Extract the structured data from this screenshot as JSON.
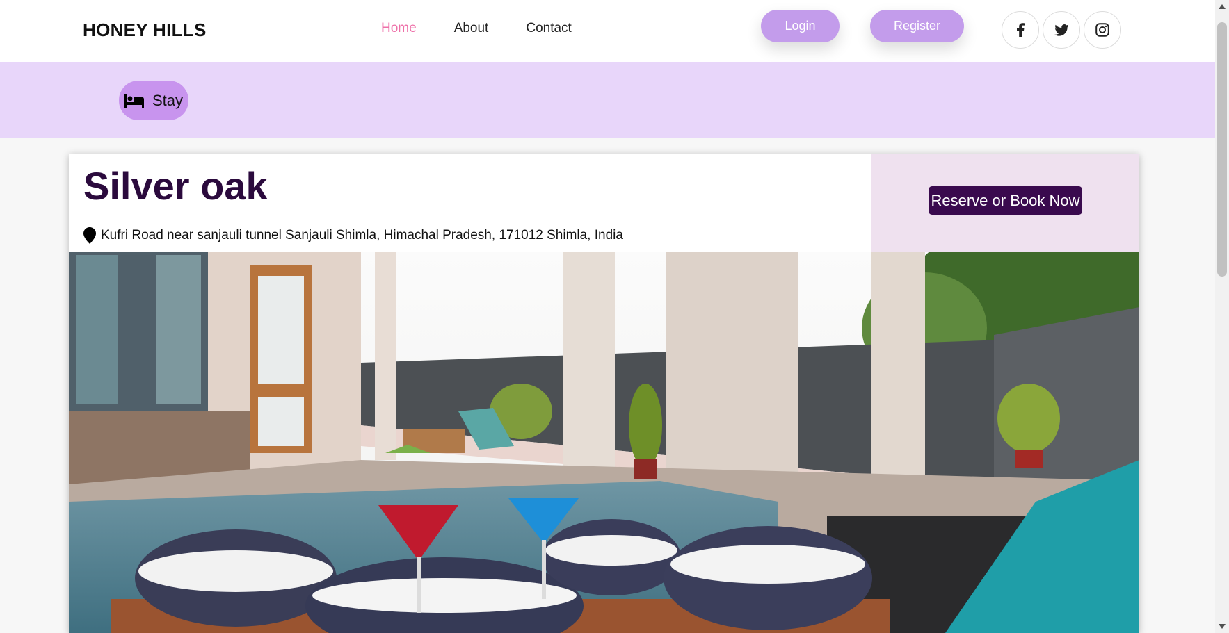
{
  "header": {
    "brand": "HONEY HILLS",
    "nav": [
      {
        "label": "Home",
        "active": true
      },
      {
        "label": "About",
        "active": false
      },
      {
        "label": "Contact",
        "active": false
      }
    ],
    "login_label": "Login",
    "register_label": "Register",
    "social_icons": [
      "facebook-icon",
      "twitter-icon",
      "instagram-icon"
    ]
  },
  "category_bar": {
    "stay_label": "Stay",
    "stay_icon": "bed-icon"
  },
  "listing": {
    "name": "Silver oak",
    "address": "Kufri Road near sanjauli tunnel Sanjauli Shimla, Himachal Pradesh, 171012 Shimla, India",
    "book_button_label": "Reserve or Book Now"
  },
  "colors": {
    "brand_pink": "#ee6fa8",
    "pill_purple": "#c39ceb",
    "band_lavender": "#e8d6fa",
    "title_dark": "#2b0a3d",
    "book_button": "#3a0a4e"
  }
}
